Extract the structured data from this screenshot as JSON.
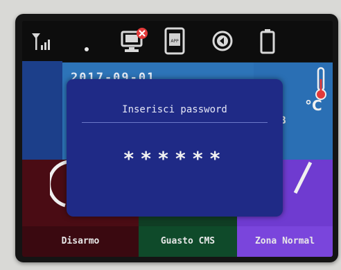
{
  "status_bar": {
    "icons": [
      "signal-icon",
      "dot-icon",
      "network-error-icon",
      "app-icon",
      "arm-icon",
      "battery-icon"
    ],
    "app_label": "APP"
  },
  "home": {
    "date": "2017-09-01",
    "temperature_unit": "°C",
    "temperature_suffix": "B"
  },
  "dialog": {
    "title": "Inserisci password",
    "password_mask": "******"
  },
  "bottom_bar": {
    "items": [
      {
        "label": "Disarmo"
      },
      {
        "label": "Guasto CMS"
      },
      {
        "label": "Zona Normal"
      }
    ]
  },
  "colors": {
    "dialog_bg": "#1f2a86",
    "tile_blue": "#2d74b8",
    "tile_red": "#3a0910",
    "tile_green": "#0f4a2a",
    "tile_purple": "#7a45dc"
  }
}
